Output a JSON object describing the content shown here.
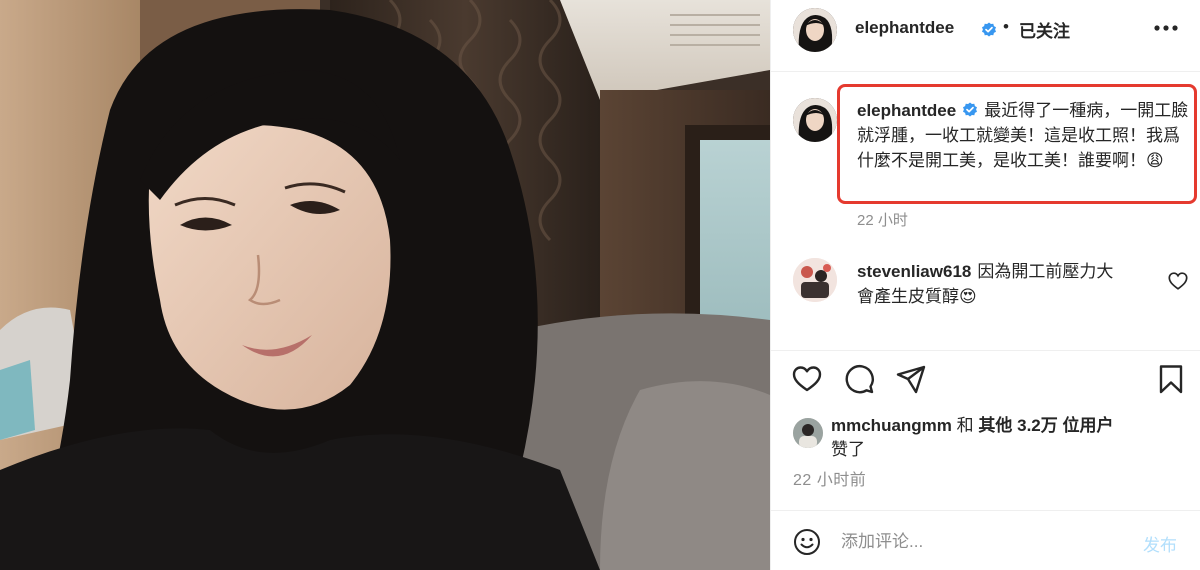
{
  "post": {
    "author": "elephantdee",
    "follow_status": "已关注",
    "separator": "•"
  },
  "caption": {
    "author": "elephantdee",
    "text": "最近得了一種病，一開工臉就浮腫，一收工就變美！這是收工照！我爲什麼不是開工美，是收工美！誰要啊！😩",
    "time": "22 小时"
  },
  "comments": [
    {
      "author": "stevenliaw618",
      "text": "因為開工前壓力大\n會產生皮質醇😍"
    }
  ],
  "likes": {
    "user": "mmchuangmm",
    "and": "和",
    "others": "其他 3.2万 位用户",
    "suffix": "赞了"
  },
  "post_time": "22 小时前",
  "comment_box": {
    "placeholder": "添加评论...",
    "post_label": "发布"
  },
  "icons": {
    "verified": "verified-badge-icon",
    "more": "more-options-icon",
    "like": "heart-icon",
    "comment": "comment-icon",
    "share": "paper-plane-icon",
    "save": "bookmark-icon",
    "emoji": "emoji-icon"
  },
  "colors": {
    "highlight_border": "#e53a2f",
    "verified": "#3897f0",
    "muted_text": "#8e8e8e",
    "post_button_disabled": "#b2dffc"
  }
}
